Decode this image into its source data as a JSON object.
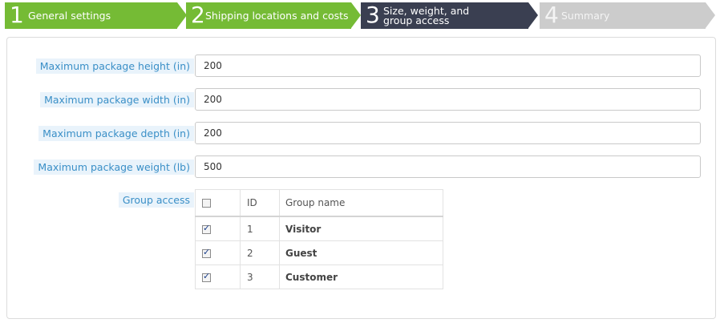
{
  "wizard": {
    "steps": [
      {
        "number": "1",
        "label": "General settings",
        "state": "done"
      },
      {
        "number": "2",
        "label": "Shipping locations and costs",
        "state": "done"
      },
      {
        "number": "3",
        "label": "Size, weight, and group access",
        "state": "current"
      },
      {
        "number": "4",
        "label": "Summary",
        "state": "todo"
      }
    ],
    "colors": {
      "done": "#75bb35",
      "current": "#3a3f51",
      "todo": "#cccccc"
    }
  },
  "form": {
    "fields": [
      {
        "label": "Maximum package height (in)",
        "value": "200"
      },
      {
        "label": "Maximum package width (in)",
        "value": "200"
      },
      {
        "label": "Maximum package depth (in)",
        "value": "200"
      },
      {
        "label": "Maximum package weight (lb)",
        "value": "500"
      }
    ],
    "group_access": {
      "label": "Group access",
      "columns": {
        "id": "ID",
        "name": "Group name"
      },
      "select_all_checked": false,
      "rows": [
        {
          "id": "1",
          "name": "Visitor",
          "checked": true
        },
        {
          "id": "2",
          "name": "Guest",
          "checked": true
        },
        {
          "id": "3",
          "name": "Customer",
          "checked": true
        }
      ]
    }
  }
}
